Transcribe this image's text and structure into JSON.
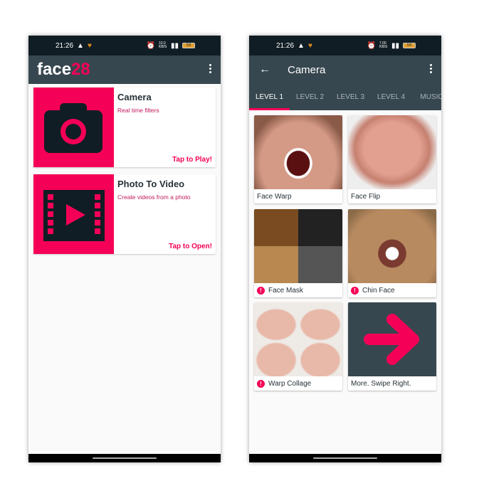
{
  "status": {
    "time": "21:26",
    "speed_left": "10.0 KB/S",
    "speed_right": "7.00 KB/S",
    "battery": "59"
  },
  "home": {
    "logo_main": "face",
    "logo_accent": "28",
    "cards": [
      {
        "title": "Camera",
        "subtitle": "Real time filters",
        "cta": "Tap to Play!",
        "icon": "camera-icon"
      },
      {
        "title": "Photo To Video",
        "subtitle": "Create videos from a photo",
        "cta": "Tap to Open!",
        "icon": "film-play-icon"
      }
    ]
  },
  "camera": {
    "title": "Camera",
    "tabs": [
      "LEVEL 1",
      "LEVEL 2",
      "LEVEL 3",
      "LEVEL 4",
      "MUSIC"
    ],
    "active_tab": 0,
    "tiles": [
      {
        "label": "Face Warp",
        "badge": false
      },
      {
        "label": "Face Flip",
        "badge": false
      },
      {
        "label": "Face Mask",
        "badge": true
      },
      {
        "label": "Chin Face",
        "badge": true
      },
      {
        "label": "Warp Collage",
        "badge": true
      },
      {
        "label": "More. Swipe Right.",
        "badge": false
      }
    ],
    "badge_glyph": "!"
  },
  "colors": {
    "accent": "#f50057",
    "appbar": "#37474f",
    "statusbar": "#101d24"
  }
}
